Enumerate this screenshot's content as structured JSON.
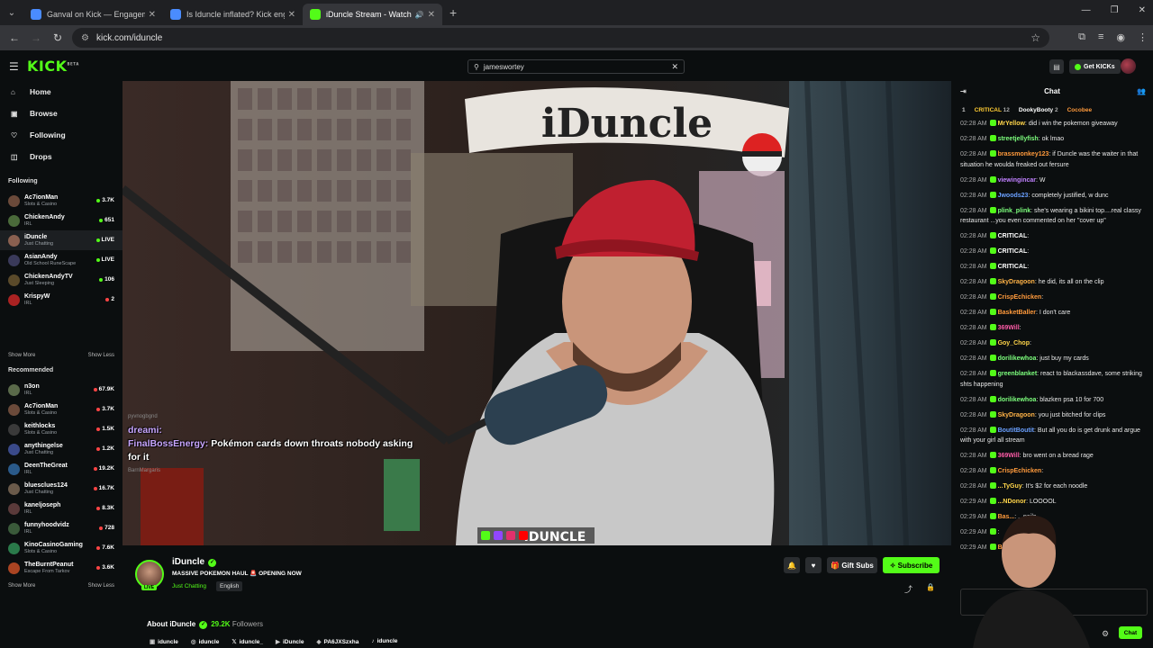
{
  "browser": {
    "tabs": [
      {
        "title": "Ganval on Kick — Engagement",
        "active": false,
        "color": "#4a8cff"
      },
      {
        "title": "Is Iduncle inflated? Kick engage",
        "active": false,
        "color": "#4a8cff"
      },
      {
        "title": "iDuncle Stream - Watch Live",
        "active": true,
        "color": "#53fc18"
      }
    ],
    "url": "kick.com/iduncle"
  },
  "header": {
    "logo": "KICK",
    "logo_badge": "BETA",
    "search_value": "jameswortey",
    "get_kicks": "Get KICKs"
  },
  "sidebar": {
    "nav": [
      {
        "label": "Home",
        "icon": "home-icon"
      },
      {
        "label": "Browse",
        "icon": "browse-icon"
      },
      {
        "label": "Following",
        "icon": "heart-icon"
      },
      {
        "label": "Drops",
        "icon": "drops-icon"
      }
    ],
    "following_title": "Following",
    "following": [
      {
        "name": "Ac7ionMan",
        "category": "Slots & Casino",
        "count": "3.7K",
        "live": true,
        "color": "#6b4a3a"
      },
      {
        "name": "ChickenAndy",
        "category": "IRL",
        "count": "651",
        "live": true,
        "color": "#4a6a3a"
      },
      {
        "name": "iDuncle",
        "category": "Just Chatting",
        "count": "LIVE",
        "live": true,
        "color": "#8a6050"
      },
      {
        "name": "AsianAndy",
        "category": "Old School RuneScape",
        "count": "LIVE",
        "live": true,
        "color": "#3a3a5a"
      },
      {
        "name": "ChickenAndyTV",
        "category": "Just Sleeping",
        "count": "106",
        "live": true,
        "color": "#5a4a2a"
      },
      {
        "name": "KrispyW",
        "category": "IRL",
        "count": "2",
        "live": false,
        "color": "#aa2222"
      }
    ],
    "show_more": "Show More",
    "show_less": "Show Less",
    "recommended_title": "Recommended",
    "recommended": [
      {
        "name": "n3on",
        "category": "IRL",
        "count": "67.9K",
        "color": "#5a6a4a"
      },
      {
        "name": "Ac7ionMan",
        "category": "Slots & Casino",
        "count": "3.7K",
        "color": "#6b4a3a"
      },
      {
        "name": "keithlocks",
        "category": "Slots & Casino",
        "count": "1.5K",
        "color": "#3a3a3a"
      },
      {
        "name": "anythingelse",
        "category": "Just Chatting",
        "count": "1.2K",
        "color": "#3a4a8a"
      },
      {
        "name": "DeenTheGreat",
        "category": "IRL",
        "count": "19.2K",
        "color": "#2a5a8a"
      },
      {
        "name": "bluesclues124",
        "category": "Just Chatting",
        "count": "16.7K",
        "color": "#6a5a4a"
      },
      {
        "name": "kaneljoseph",
        "category": "IRL",
        "count": "8.3K",
        "color": "#5a3a3a"
      },
      {
        "name": "funnyhoodvidz",
        "category": "IRL",
        "count": "728",
        "color": "#3a5a3a"
      },
      {
        "name": "KinoCasinoGaming",
        "category": "Slots & Casino",
        "count": "7.6K",
        "color": "#2a7a4a"
      },
      {
        "name": "TheBurntPeanut",
        "category": "Escape From Tarkov",
        "count": "3.6K",
        "color": "#aa4422"
      }
    ]
  },
  "overlay": {
    "line1_user": "dreami:",
    "line2_user": "FinalBossEnergy:",
    "line2_text": "Pokémon cards down throats nobody asking for it",
    "faint1": "pyvnogbgnd",
    "faint2": "BarnMargaris"
  },
  "stream": {
    "channel": "iDuncle",
    "title": "MASSIVE POKEMON HAUL 🚨 OPENING NOW",
    "category": "Just Chatting",
    "language": "English",
    "live_label": "LIVE",
    "gift_subs": "Gift Subs",
    "subscribe": "Subscribe",
    "about_label": "About iDuncle",
    "followers_count": "29.2K",
    "followers_label": "Followers",
    "socials": [
      {
        "icon": "kick-icon",
        "label": "iduncle"
      },
      {
        "icon": "instagram-icon",
        "label": "iduncle"
      },
      {
        "icon": "x-icon",
        "label": "iduncle_"
      },
      {
        "icon": "youtube-icon",
        "label": "iDuncle"
      },
      {
        "icon": "discord-icon",
        "label": "PA6JXSzxha"
      },
      {
        "icon": "tiktok-icon",
        "label": "iduncle"
      }
    ],
    "banner": "iDuncle",
    "name_plate": "IDUNCLE"
  },
  "chat": {
    "title": "Chat",
    "pinned": [
      {
        "rank": "1",
        "name": "CRITICAL",
        "amount": "12"
      },
      {
        "name": "DookyBooty",
        "amount": "2"
      },
      {
        "name": "Cocobee",
        "amount": ""
      }
    ],
    "messages": [
      {
        "time": "02:28 AM",
        "user": "MrYellow",
        "color": "#ffd54a",
        "text": "did i win the pokemon giveaway"
      },
      {
        "time": "02:28 AM",
        "user": "streetjellyfish",
        "color": "#7dff7d",
        "text": "ok lmao"
      },
      {
        "time": "02:28 AM",
        "user": "brassmonkey123",
        "color": "#ff9a3c",
        "text": "if Duncle was the waiter in that situation he woulda freaked out fersure"
      },
      {
        "time": "02:28 AM",
        "user": "viewingincar",
        "color": "#c080ff",
        "text": "W"
      },
      {
        "time": "02:28 AM",
        "user": "Jwoods23",
        "color": "#6aa0ff",
        "text": "completely justified, w dunc"
      },
      {
        "time": "02:28 AM",
        "user": "plink_plink",
        "color": "#7dff7d",
        "text": "she's wearing a bikini top....real classy restaurant ...you even commented on her \"cover up\""
      },
      {
        "time": "02:28 AM",
        "user": "CRITICAL",
        "color": "#ffffff",
        "text": ""
      },
      {
        "time": "02:28 AM",
        "user": "CRITICAL",
        "color": "#ffffff",
        "text": ""
      },
      {
        "time": "02:28 AM",
        "user": "CRITICAL",
        "color": "#ffffff",
        "text": ""
      },
      {
        "time": "02:28 AM",
        "user": "SkyDragoon",
        "color": "#ffb347",
        "text": "he did, its all on the clip"
      },
      {
        "time": "02:28 AM",
        "user": "CrispEchicken",
        "color": "#ff9a3c",
        "text": ""
      },
      {
        "time": "02:28 AM",
        "user": "BasketBaller",
        "color": "#ff9a3c",
        "text": "I don't care"
      },
      {
        "time": "02:28 AM",
        "user": "369Will",
        "color": "#ff5ca8",
        "text": ""
      },
      {
        "time": "02:28 AM",
        "user": "Goy_Chop",
        "color": "#ffd54a",
        "text": ""
      },
      {
        "time": "02:28 AM",
        "user": "dorilikewhoa",
        "color": "#7dff7d",
        "text": "just buy my cards"
      },
      {
        "time": "02:28 AM",
        "user": "greenblanket",
        "color": "#7dff7d",
        "text": "react to blackassdave, some striking shts happening"
      },
      {
        "time": "02:28 AM",
        "user": "dorilikewhoa",
        "color": "#7dff7d",
        "text": "blazken psa 10 for 700"
      },
      {
        "time": "02:28 AM",
        "user": "SkyDragoon",
        "color": "#ffb347",
        "text": "you just bitched for clips"
      },
      {
        "time": "02:28 AM",
        "user": "BoutitBoutit",
        "color": "#6aa0ff",
        "text": "But all you do is get drunk and argue with your girl all stream"
      },
      {
        "time": "02:28 AM",
        "user": "369Will",
        "color": "#ff5ca8",
        "text": "bro went on a bread rage"
      },
      {
        "time": "02:28 AM",
        "user": "CrispEchicken",
        "color": "#ff9a3c",
        "text": ""
      },
      {
        "time": "02:28 AM",
        "user": "...TyGuy",
        "color": "#ffd54a",
        "text": "It's $2 for each noodle"
      },
      {
        "time": "02:29 AM",
        "user": "...NDonor",
        "color": "#ffd54a",
        "text": "LOOOOL"
      },
      {
        "time": "02:29 AM",
        "user": "Bas...",
        "color": "#ff9a3c",
        "text": "...nails"
      },
      {
        "time": "02:29 AM",
        "user": "",
        "color": "#ffffff",
        "text": ""
      },
      {
        "time": "02:29 AM",
        "user": "Bask...",
        "color": "#ff9a3c",
        "text": ""
      }
    ],
    "send": "Chat"
  }
}
